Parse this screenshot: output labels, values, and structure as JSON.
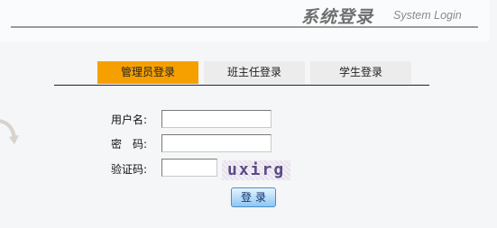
{
  "header": {
    "title_zh": "系统登录",
    "title_en": "System Login"
  },
  "tabs": [
    {
      "label": "管理员登录",
      "active": true
    },
    {
      "label": "班主任登录",
      "active": false
    },
    {
      "label": "学生登录",
      "active": false
    }
  ],
  "form": {
    "username_label": "用户名:",
    "username_value": "",
    "password_label": "密　码:",
    "password_value": "",
    "captcha_label": "验证码:",
    "captcha_value": "",
    "captcha_image_text": "uxirg",
    "login_label": "登录"
  },
  "colors": {
    "active_tab": "#f6a000",
    "inactive_tab": "#ececec",
    "button": "#8fc6f2"
  }
}
